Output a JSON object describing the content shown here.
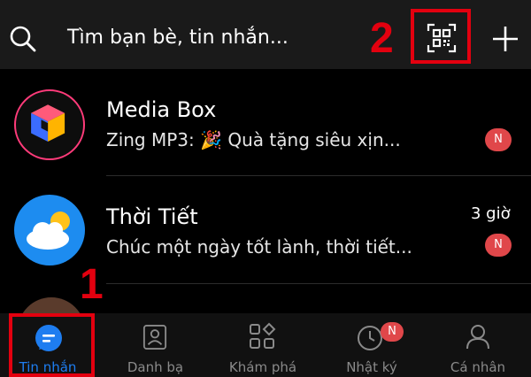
{
  "header": {
    "search_placeholder": "Tìm bạn bè, tin nhắn...",
    "icons": [
      "search-icon",
      "qr-code-icon",
      "plus-icon"
    ]
  },
  "annotations": {
    "qr": "2",
    "tab": "1"
  },
  "chats": [
    {
      "name": "Media Box",
      "preview": "Zing MP3: 🎉 Quà tặng siêu xịn...",
      "time": "",
      "badge": "N",
      "avatar": "media-box-logo"
    },
    {
      "name": "Thời Tiết",
      "preview": "Chúc một ngày tốt lành, thời tiết...",
      "time": "3 giờ",
      "badge": "N",
      "avatar": "weather-logo"
    }
  ],
  "bottom_nav": [
    {
      "label": "Tin nhắn",
      "icon": "message-icon",
      "active": true
    },
    {
      "label": "Danh bạ",
      "icon": "contacts-icon",
      "active": false
    },
    {
      "label": "Khám phá",
      "icon": "discover-icon",
      "active": false
    },
    {
      "label": "Nhật ký",
      "icon": "clock-icon",
      "active": false,
      "badge": "N"
    },
    {
      "label": "Cá nhân",
      "icon": "person-icon",
      "active": false
    }
  ],
  "colors": {
    "accent": "#1e7df0",
    "badge": "#e0474a",
    "annotation": "#e3000f"
  }
}
